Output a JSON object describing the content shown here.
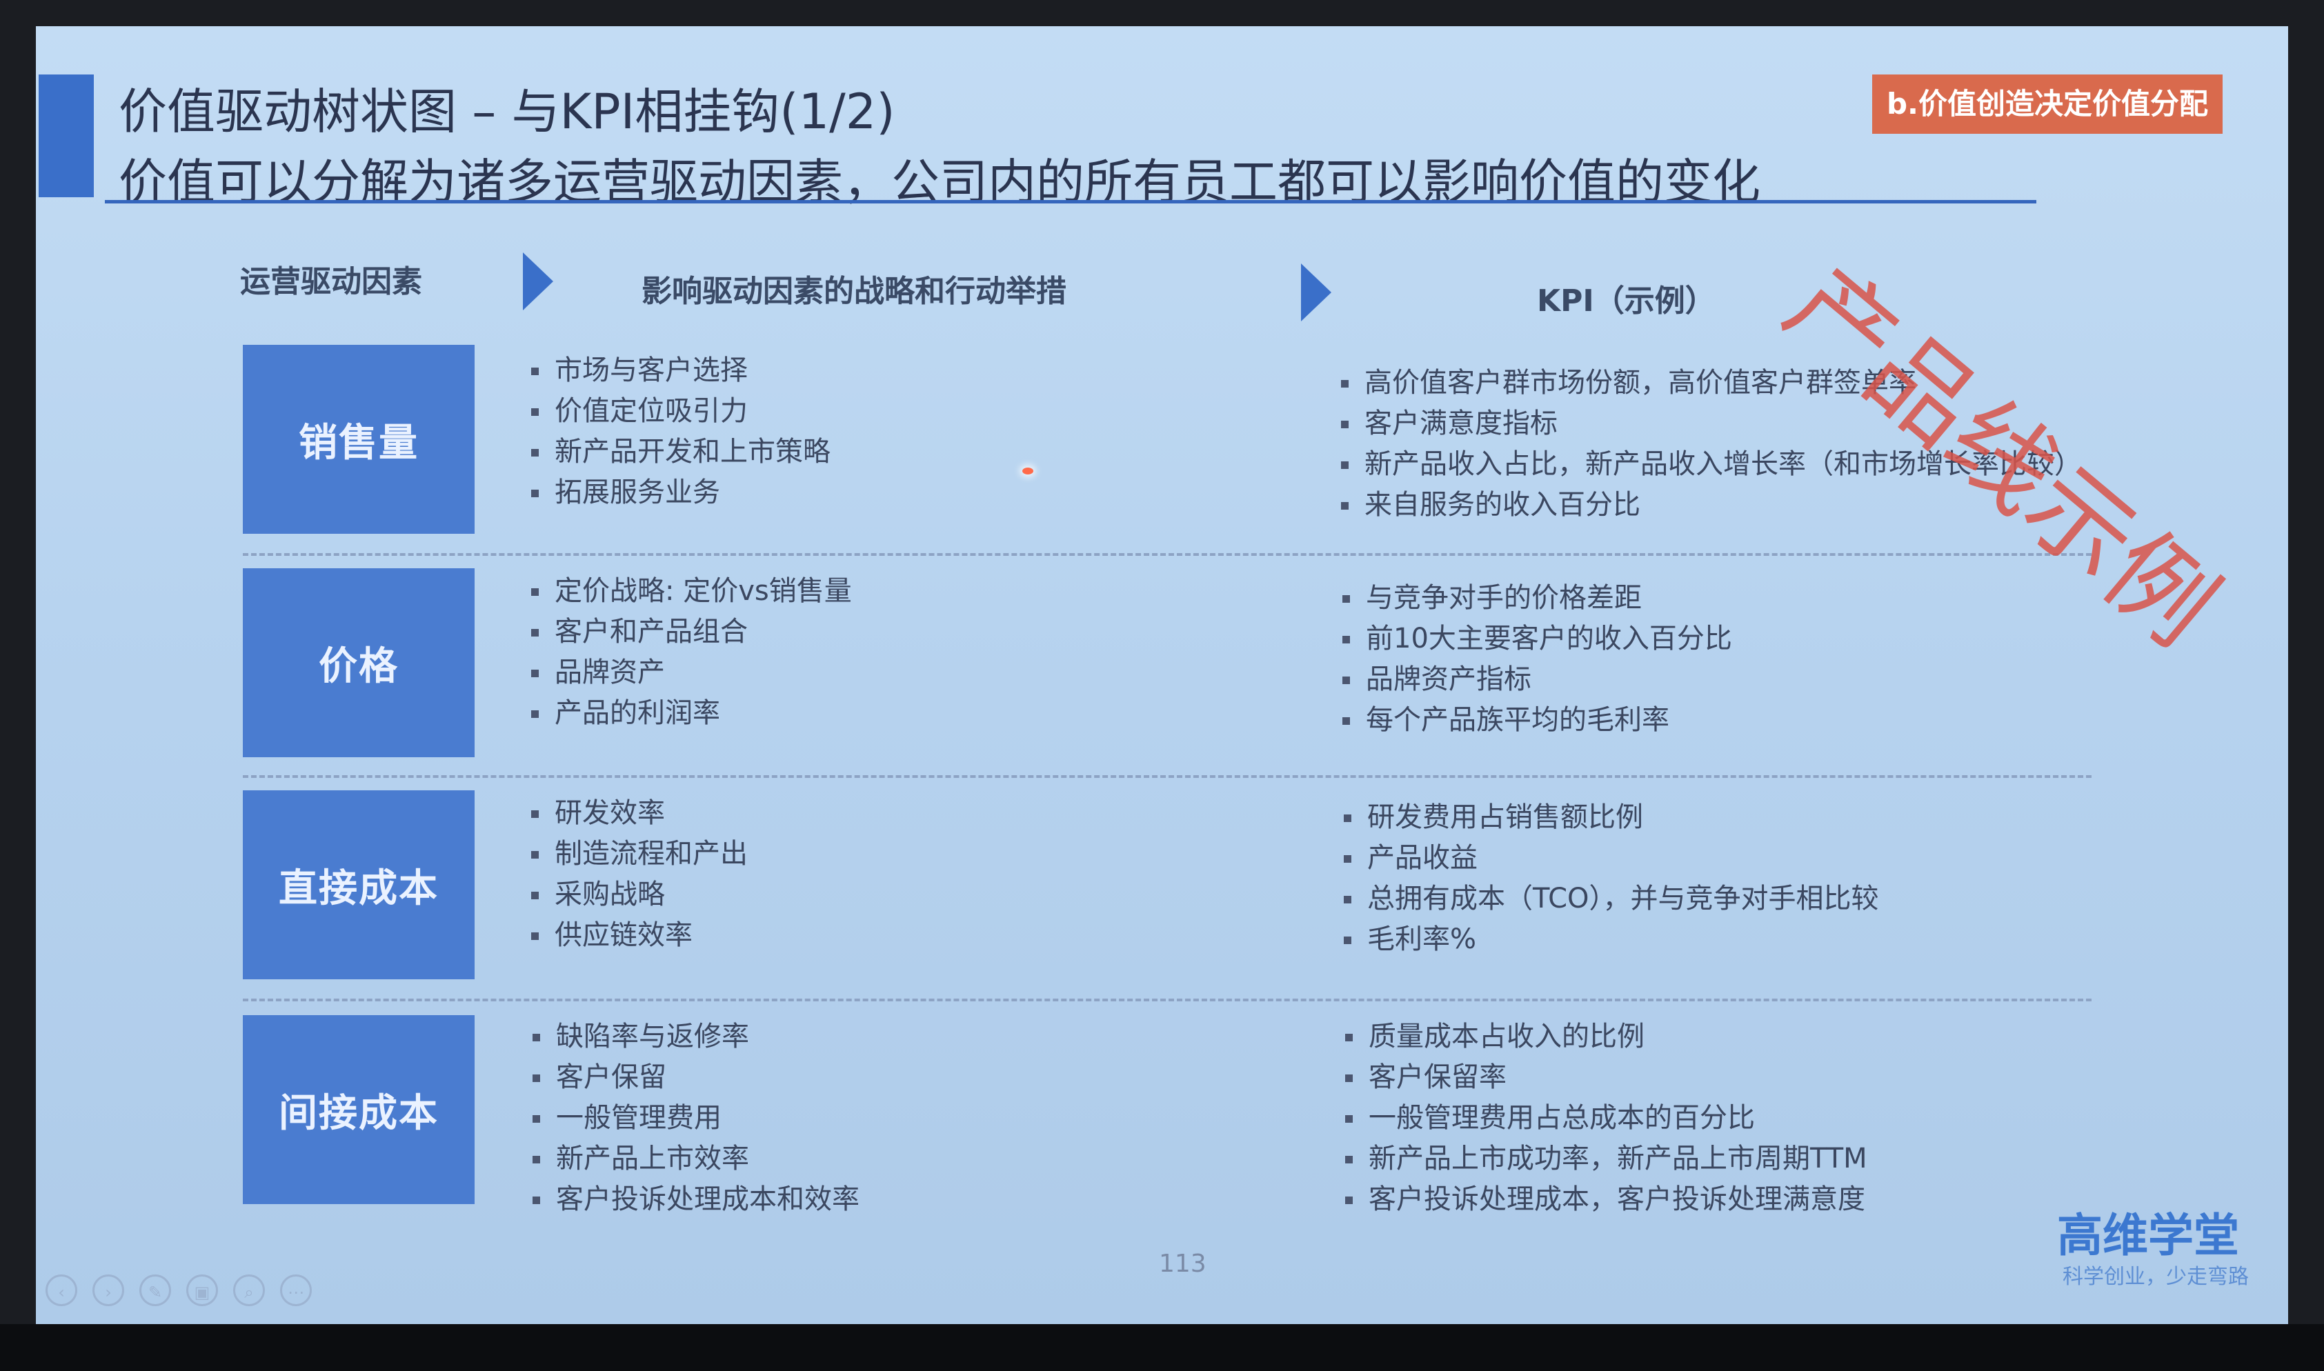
{
  "slide": {
    "title_line1": "价值驱动树状图 – 与KPI相挂钩(1/2)",
    "title_line2": "价值可以分解为诸多运营驱动因素，公司内的所有员工都可以影响价值的变化",
    "section_tag": "b.价值创造决定价值分配",
    "stamp_text": "产品线示例",
    "page_number": "113",
    "brand_name": "高维学堂",
    "brand_slogan": "科学创业，少走弯路"
  },
  "headers": {
    "drivers": "运营驱动因素",
    "actions": "影响驱动因素的战略和行动举措",
    "kpi": "KPI（示例）"
  },
  "rows": [
    {
      "driver": "销售量",
      "actions": [
        "市场与客户选择",
        "价值定位吸引力",
        "新产品开发和上市策略",
        "拓展服务业务"
      ],
      "kpis": [
        "高价值客户群市场份额，高价值客户群签单率",
        "客户满意度指标",
        "新产品收入占比，新产品收入增长率（和市场增长率比较）",
        "来自服务的收入百分比"
      ]
    },
    {
      "driver": "价格",
      "actions": [
        "定价战略: 定价vs销售量",
        "客户和产品组合",
        "品牌资产",
        "产品的利润率"
      ],
      "kpis": [
        "与竞争对手的价格差距",
        "前10大主要客户的收入百分比",
        "品牌资产指标",
        "每个产品族平均的毛利率"
      ]
    },
    {
      "driver": "直接成本",
      "actions": [
        "研发效率",
        "制造流程和产出",
        "采购战略",
        "供应链效率"
      ],
      "kpis": [
        "研发费用占销售额比例",
        "产品收益",
        "总拥有成本（TCO），并与竞争对手相比较",
        "毛利率%"
      ]
    },
    {
      "driver": "间接成本",
      "actions": [
        "缺陷率与返修率",
        "客户保留",
        "一般管理费用",
        "新产品上市效率",
        "客户投诉处理成本和效率"
      ],
      "kpis": [
        "质量成本占收入的比例",
        "客户保留率",
        "一般管理费用占总成本的百分比",
        "新产品上市成功率，新产品上市周期TTM",
        "客户投诉处理成本，客户投诉处理满意度"
      ]
    }
  ],
  "controls": [
    {
      "icon": "prev-icon",
      "glyph": "‹"
    },
    {
      "icon": "next-icon",
      "glyph": "›"
    },
    {
      "icon": "pen-icon",
      "glyph": "✎"
    },
    {
      "icon": "slides-icon",
      "glyph": "▣"
    },
    {
      "icon": "zoom-icon",
      "glyph": "⌕"
    },
    {
      "icon": "more-icon",
      "glyph": "⋯"
    }
  ],
  "colors": {
    "accent_blue": "#3a6fc9",
    "box_blue": "#4a7cd0",
    "tag_red": "#d96a4d",
    "stamp_red": "#d9544a"
  }
}
